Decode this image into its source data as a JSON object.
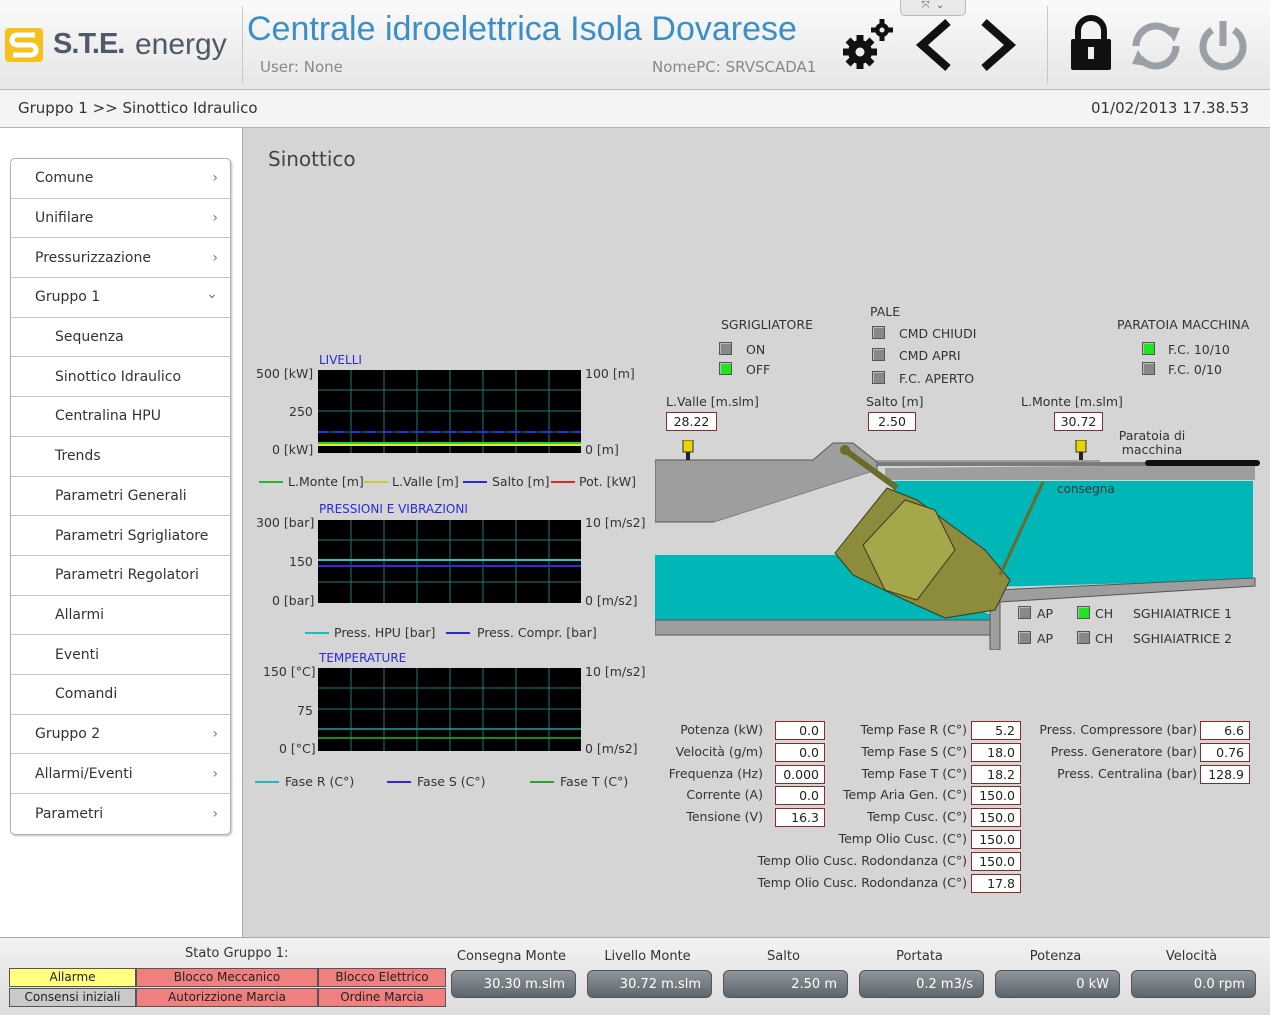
{
  "header": {
    "logo_brand": "S.T.E.",
    "logo_word": "energy",
    "title": "Centrale idroelettrica Isola Dovarese",
    "user": "User: None",
    "pc": "NomePC: SRVSCADA1"
  },
  "crumb": {
    "path": "Gruppo 1 >> Sinottico Idraulico",
    "datetime": "01/02/2013 17.38.53"
  },
  "sidebar": {
    "items": [
      {
        "label": "Comune",
        "chev": "›"
      },
      {
        "label": "Unifilare",
        "chev": "›"
      },
      {
        "label": "Pressurizzazione",
        "chev": "›"
      },
      {
        "label": "Gruppo 1",
        "chev": "⌄"
      },
      {
        "label": "Sequenza"
      },
      {
        "label": "Sinottico Idraulico"
      },
      {
        "label": "Centralina HPU"
      },
      {
        "label": "Trends"
      },
      {
        "label": "Parametri Generali"
      },
      {
        "label": "Parametri Sgrigliatore"
      },
      {
        "label": "Parametri Regolatori"
      },
      {
        "label": "Allarmi"
      },
      {
        "label": "Eventi"
      },
      {
        "label": "Comandi"
      },
      {
        "label": "Gruppo 2",
        "chev": "›"
      },
      {
        "label": "Allarmi/Eventi",
        "chev": "›"
      },
      {
        "label": "Parametri",
        "chev": "›"
      }
    ]
  },
  "main": {
    "title": "Sinottico"
  },
  "charts": {
    "livelli": {
      "title": "LIVELLI",
      "left_top": "500 [kW]",
      "left_mid": "250",
      "left_bot": "0 [kW]",
      "right_top": "100 [m]",
      "right_bot": "0 [m]",
      "legend": [
        "L.Monte [m]",
        "L.Valle [m]",
        "Salto [m]",
        "Pot. [kW]"
      ]
    },
    "pressioni": {
      "title": "PRESSIONI E VIBRAZIONI",
      "left_top": "300 [bar]",
      "left_mid": "150",
      "left_bot": "0 [bar]",
      "right_top": "10 [m/s2]",
      "right_bot": "0 [m/s2]",
      "legend": [
        "Press. HPU [bar]",
        "Press. Compr. [bar]"
      ]
    },
    "temperature": {
      "title": "TEMPERATURE",
      "left_top": "150 [°C]",
      "left_mid": "75",
      "left_bot": "0 [°C]",
      "right_top": "10 [m/s2]",
      "right_bot": "0 [m/s2]",
      "legend": [
        "Fase R (C°)",
        "Fase S (C°)",
        "Fase T (C°)"
      ]
    }
  },
  "synoptic": {
    "sgrigliatore": {
      "title": "SGRIGLIATORE",
      "on": "ON",
      "off": "OFF"
    },
    "pale": {
      "title": "PALE",
      "chiudi": "CMD CHIUDI",
      "apri": "CMD APRI",
      "aperto": "F.C. APERTO"
    },
    "paratoia": {
      "title": "PARATOIA MACCHINA",
      "fc10": "F.C. 10/10",
      "fc0": "F.C.  0/10"
    },
    "lvalle": {
      "label": "L.Valle [m.slm]",
      "value": "28.22"
    },
    "salto": {
      "label": "Salto [m]",
      "value": "2.50"
    },
    "lmonte": {
      "label": "L.Monte [m.slm]",
      "value": "30.72"
    },
    "paratoia_label": "Paratoia di macchina",
    "consegna": "consegna",
    "sghia1": {
      "ap": "AP",
      "ch": "CH",
      "name": "SGHIAIATRICE 1"
    },
    "sghia2": {
      "ap": "AP",
      "ch": "CH",
      "name": "SGHIAIATRICE 2"
    }
  },
  "values": {
    "col1": [
      {
        "label": "Potenza (kW)",
        "value": "0.0"
      },
      {
        "label": "Velocità (g/m)",
        "value": "0.0"
      },
      {
        "label": "Frequenza (Hz)",
        "value": "0.000"
      },
      {
        "label": "Corrente (A)",
        "value": "0.0"
      },
      {
        "label": "Tensione (V)",
        "value": "16.3"
      }
    ],
    "col2": [
      {
        "label": "Temp Fase R (C°)",
        "value": "5.2"
      },
      {
        "label": "Temp Fase S (C°)",
        "value": "18.0"
      },
      {
        "label": "Temp Fase T (C°)",
        "value": "18.2"
      },
      {
        "label": "Temp Aria Gen. (C°)",
        "value": "150.0"
      },
      {
        "label": "Temp Cusc. (C°)",
        "value": "150.0"
      },
      {
        "label": "Temp Olio Cusc. (C°)",
        "value": "150.0"
      },
      {
        "label": "Temp Olio Cusc. Rodondanza (C°)",
        "value": "150.0"
      },
      {
        "label": "Temp Olio Cusc. Rodondanza (C°)",
        "value": "17.8"
      }
    ],
    "col3": [
      {
        "label": "Press. Compressore (bar)",
        "value": "6.6"
      },
      {
        "label": "Press. Generatore (bar)",
        "value": "0.76"
      },
      {
        "label": "Press. Centralina (bar)",
        "value": "128.9"
      }
    ]
  },
  "footer": {
    "stato_title": "Stato Gruppo 1:",
    "cells": [
      "Allarme",
      "Blocco Meccanico",
      "Blocco Elettrico",
      "Consensi iniziali",
      "Autorizzione Marcia",
      "Ordine Marcia"
    ],
    "kpis": [
      {
        "title": "Consegna Monte",
        "value": "30.30  m.slm"
      },
      {
        "title": "Livello Monte",
        "value": "30.72  m.slm"
      },
      {
        "title": "Salto",
        "value": "2.50  m"
      },
      {
        "title": "Portata",
        "value": "0.2  m3/s"
      },
      {
        "title": "Potenza",
        "value": "0  kW"
      },
      {
        "title": "Velocità",
        "value": "0.0  rpm"
      }
    ]
  },
  "colors": {
    "accent_title": "#3a8fc8",
    "water": "#00b7b7",
    "alarm_yellow": "#ffff80",
    "alarm_red": "#f08080",
    "led_on": "#1ee51e"
  }
}
